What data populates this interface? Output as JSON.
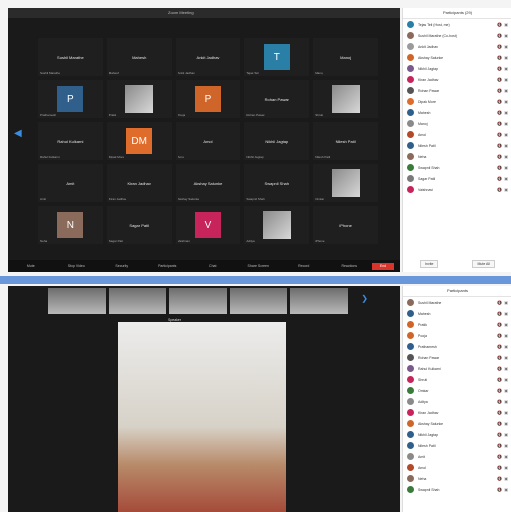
{
  "top_window": {
    "title": "Zoom Meeting",
    "tiles": [
      {
        "label": "Sushil Marathe",
        "caption": "Sushil Marathe",
        "avatar": "",
        "color": ""
      },
      {
        "label": "Mahesh",
        "caption": "Mahesh",
        "avatar": "",
        "color": ""
      },
      {
        "label": "Ankit Jadhav",
        "caption": "Ankit Jadhav",
        "avatar": "",
        "color": ""
      },
      {
        "label": "",
        "caption": "Tejas Teli",
        "avatar": "T",
        "color": "#2a7fa6"
      },
      {
        "label": "Manoj",
        "caption": "Manoj",
        "avatar": "",
        "color": ""
      },
      {
        "label": "",
        "caption": "Prathamesh",
        "avatar": "P",
        "color": "#2f5f8a"
      },
      {
        "label": "",
        "caption": "Pratik",
        "avatar": "photo",
        "color": ""
      },
      {
        "label": "",
        "caption": "Pooja",
        "avatar": "P",
        "color": "#d0652a"
      },
      {
        "label": "Rohan Pawar",
        "caption": "Rohan Pawar",
        "avatar": "",
        "color": ""
      },
      {
        "label": "",
        "caption": "Shruti",
        "avatar": "photo",
        "color": ""
      },
      {
        "label": "Rahul Kulkarni",
        "caption": "Rahul Kulkarni",
        "avatar": "",
        "color": ""
      },
      {
        "label": "",
        "caption": "Dipak More",
        "avatar": "DM",
        "color": "#e06c2b"
      },
      {
        "label": "Amol",
        "caption": "Amol",
        "avatar": "",
        "color": ""
      },
      {
        "label": "Nikhil Jagtap",
        "caption": "Nikhil Jagtap",
        "avatar": "",
        "color": ""
      },
      {
        "label": "Nilesh Patil",
        "caption": "Nilesh Patil",
        "avatar": "",
        "color": ""
      },
      {
        "label": "Amit",
        "caption": "Amit",
        "avatar": "",
        "color": ""
      },
      {
        "label": "Kiran Jadhav",
        "caption": "Kiran Jadhav",
        "avatar": "",
        "color": ""
      },
      {
        "label": "Akshay Salunke",
        "caption": "Akshay Salunke",
        "avatar": "",
        "color": ""
      },
      {
        "label": "Swapnil Shah",
        "caption": "Swapnil Shah",
        "avatar": "",
        "color": ""
      },
      {
        "label": "",
        "caption": "Omkar",
        "avatar": "photo",
        "color": ""
      },
      {
        "label": "",
        "caption": "Neha",
        "avatar": "N",
        "color": "#8a6a5a"
      },
      {
        "label": "Sagar Patil",
        "caption": "Sagar Patil",
        "avatar": "",
        "color": ""
      },
      {
        "label": "",
        "caption": "Vaishnavi",
        "avatar": "V",
        "color": "#c7245c"
      },
      {
        "label": "",
        "caption": "Aditya",
        "avatar": "photo",
        "color": ""
      },
      {
        "label": "iPhone",
        "caption": "iPhone",
        "avatar": "",
        "color": ""
      }
    ],
    "toolbar": [
      "Mute",
      "Stop Video",
      "Security",
      "Participants",
      "Chat",
      "Share Screen",
      "Record",
      "Reactions",
      "End"
    ]
  },
  "top_participants": {
    "title": "Participants (29)",
    "rows": [
      {
        "name": "Tejas Teli (Host, me)",
        "color": "#2a7fa6"
      },
      {
        "name": "Sushil Marathe (Co-host)",
        "color": "#8a6a5a"
      },
      {
        "name": "Ankit Jadhav",
        "color": "#9a9a9a"
      },
      {
        "name": "Akshay Salunke",
        "color": "#d0652a"
      },
      {
        "name": "Nikhil Jagtap",
        "color": "#7a5a8a"
      },
      {
        "name": "Kiran Jadhav",
        "color": "#c7245c"
      },
      {
        "name": "Rohan Pawar",
        "color": "#555555"
      },
      {
        "name": "Dipak More",
        "color": "#e06c2b"
      },
      {
        "name": "Mahesh",
        "color": "#2f5f8a"
      },
      {
        "name": "Manoj",
        "color": "#8a8a8a"
      },
      {
        "name": "Amol",
        "color": "#b04a2a"
      },
      {
        "name": "Nilesh Patil",
        "color": "#2f5f8a"
      },
      {
        "name": "Neha",
        "color": "#8a6a5a"
      },
      {
        "name": "Swapnil Shah",
        "color": "#3a7a3a"
      },
      {
        "name": "Sagar Patil",
        "color": "#7a7a7a"
      },
      {
        "name": "Vaishnavi",
        "color": "#c7245c"
      }
    ],
    "invite": "Invite",
    "mute_all": "Mute All"
  },
  "bottom_window": {
    "speaker": "Speaker",
    "thumb_count": 5
  },
  "bottom_participants": {
    "title": "Participants",
    "rows": [
      {
        "name": "Sushil Marathe",
        "color": "#8a6a5a"
      },
      {
        "name": "Mahesh",
        "color": "#2f5f8a"
      },
      {
        "name": "Pratik",
        "color": "#d0652a"
      },
      {
        "name": "Pooja",
        "color": "#d0652a"
      },
      {
        "name": "Prathamesh",
        "color": "#2f5f8a"
      },
      {
        "name": "Rohan Pawar",
        "color": "#555555"
      },
      {
        "name": "Rahul Kulkarni",
        "color": "#7a5a8a"
      },
      {
        "name": "Shruti",
        "color": "#c7245c"
      },
      {
        "name": "Omkar",
        "color": "#3a7a3a"
      },
      {
        "name": "Aditya",
        "color": "#8a8a8a"
      },
      {
        "name": "Kiran Jadhav",
        "color": "#c7245c"
      },
      {
        "name": "Akshay Salunke",
        "color": "#d0652a"
      },
      {
        "name": "Nikhil Jagtap",
        "color": "#2f5f8a"
      },
      {
        "name": "Nilesh Patil",
        "color": "#2f5f8a"
      },
      {
        "name": "Amit",
        "color": "#8a8a8a"
      },
      {
        "name": "Amol",
        "color": "#b04a2a"
      },
      {
        "name": "Neha",
        "color": "#8a6a5a"
      },
      {
        "name": "Swapnil Shah",
        "color": "#3a7a3a"
      }
    ]
  }
}
